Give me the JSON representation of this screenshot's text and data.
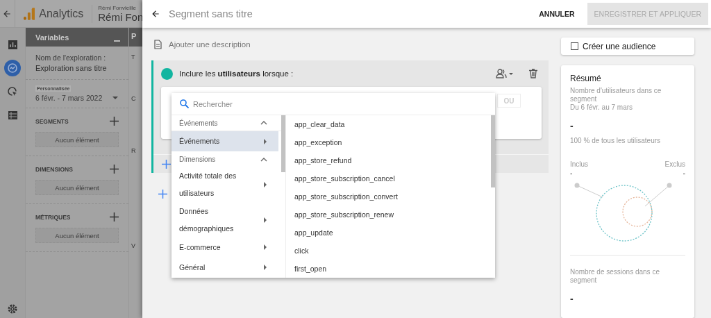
{
  "app": {
    "title": "Analytics",
    "account_small": "Rémi Fonvieille",
    "account_large": "Rémi Fon",
    "rail": [
      {
        "kind": "reports",
        "selected": false
      },
      {
        "kind": "explore",
        "selected": true
      },
      {
        "kind": "advertising",
        "selected": false
      },
      {
        "kind": "configure",
        "selected": false
      }
    ],
    "variables": {
      "title": "Variables",
      "exploration_label": "Nom de l'exploration :",
      "exploration_name": "Exploration sans titre",
      "date_badge": "Personnalisée",
      "date_range": "6 févr. - 7 mars 2022",
      "sections": [
        {
          "title": "SEGMENTS",
          "empty_text": "Aucun élément"
        },
        {
          "title": "DIMENSIONS",
          "empty_text": "Aucun élément"
        },
        {
          "title": "MÉTRIQUES",
          "empty_text": "Aucun élément"
        }
      ]
    },
    "column_2": {
      "header": "P",
      "labels": [
        "T",
        "C",
        "R",
        "V"
      ]
    }
  },
  "segment_editor": {
    "title": "Segment sans titre",
    "cancel": "ANNULER",
    "save": {
      "label": "ENREGISTRER ET APPLIQUER",
      "disabled": true
    },
    "description_placeholder": "Ajouter une description",
    "condition": {
      "heading": "Inclure les **utilisateurs** lorsque :",
      "or_button": "OU"
    },
    "dropdown": {
      "placeholder": "Rechercher",
      "groups": [
        {
          "label": "Événements",
          "expanded": true,
          "items": [
            {
              "label": "Événements",
              "selected": true
            }
          ]
        },
        {
          "label": "Dimensions",
          "expanded": true,
          "items": [
            {
              "label": "Activité totale des utilisateurs",
              "selected": false
            },
            {
              "label": "Données démographiques",
              "selected": false
            },
            {
              "label": "E-commerce",
              "selected": false
            },
            {
              "label": "Général",
              "selected": false
            }
          ]
        }
      ],
      "options": [
        "app_clear_data",
        "app_exception",
        "app_store_refund",
        "app_store_subscription_cancel",
        "app_store_subscription_convert",
        "app_store_subscription_renew",
        "app_update",
        "click",
        "first_open"
      ]
    },
    "audience": {
      "label": "Créer une audience",
      "checked": false
    },
    "summary": {
      "title": "Résumé",
      "users_label": "Nombre d'utilisateurs dans ce segment",
      "period": "Du 6 févr. au 7 mars",
      "users_value": "-",
      "share": "100 % de tous les utilisateurs",
      "included_label": "Inclus",
      "excluded_label": "Exclus",
      "included_value": "-",
      "excluded_value": "-",
      "sessions_label": "Nombre de sessions dans ce segment",
      "sessions_value": "-"
    }
  }
}
